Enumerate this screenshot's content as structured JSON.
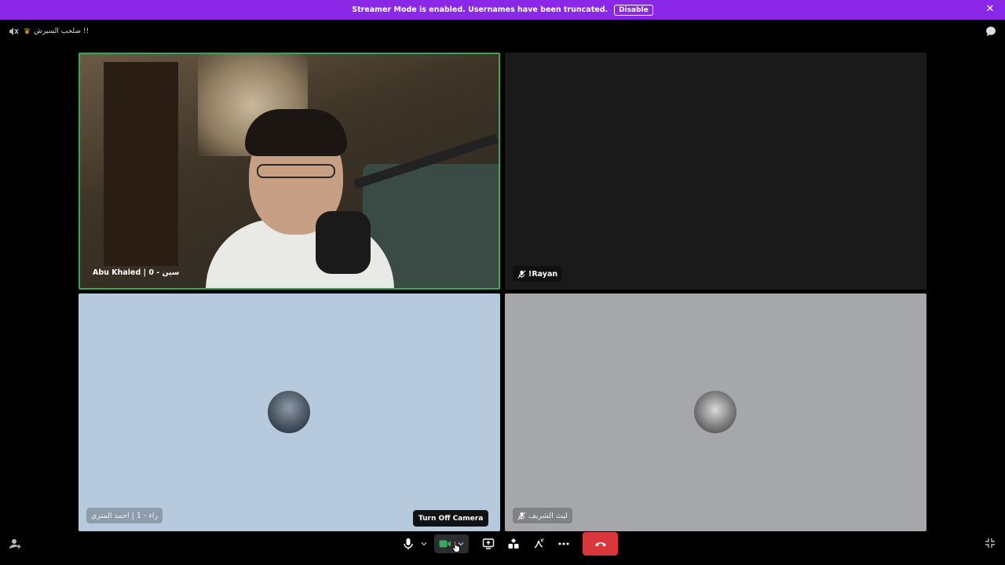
{
  "banner": {
    "message": "Streamer Mode is enabled. Usernames have been truncated.",
    "disable_label": "Disable",
    "background": "#8b27e6"
  },
  "header": {
    "channel_name": "صلحب السيرش !!",
    "icons": [
      "voice-settings-icon",
      "crown-icon",
      "chat-icon"
    ]
  },
  "participants": [
    {
      "name": "Abu Khaled | 0 - سين",
      "video": true,
      "speaking": true
    },
    {
      "name": "!Rayan",
      "video": false,
      "muted": true
    },
    {
      "name": "راء - 1 | احمد المنزي",
      "video": false
    },
    {
      "name": "ليث الشريف",
      "video": false,
      "muted": true
    }
  ],
  "controls": {
    "tooltip": "Turn Off Camera",
    "leave_color": "#da373c",
    "camera_on_color": "#3ba55c",
    "icons": [
      "microphone-icon",
      "camera-icon",
      "screen-share-icon",
      "activities-icon",
      "soundboard-icon",
      "more-icon",
      "leave-call-icon",
      "invite-icon",
      "fullscreen-icon"
    ]
  }
}
